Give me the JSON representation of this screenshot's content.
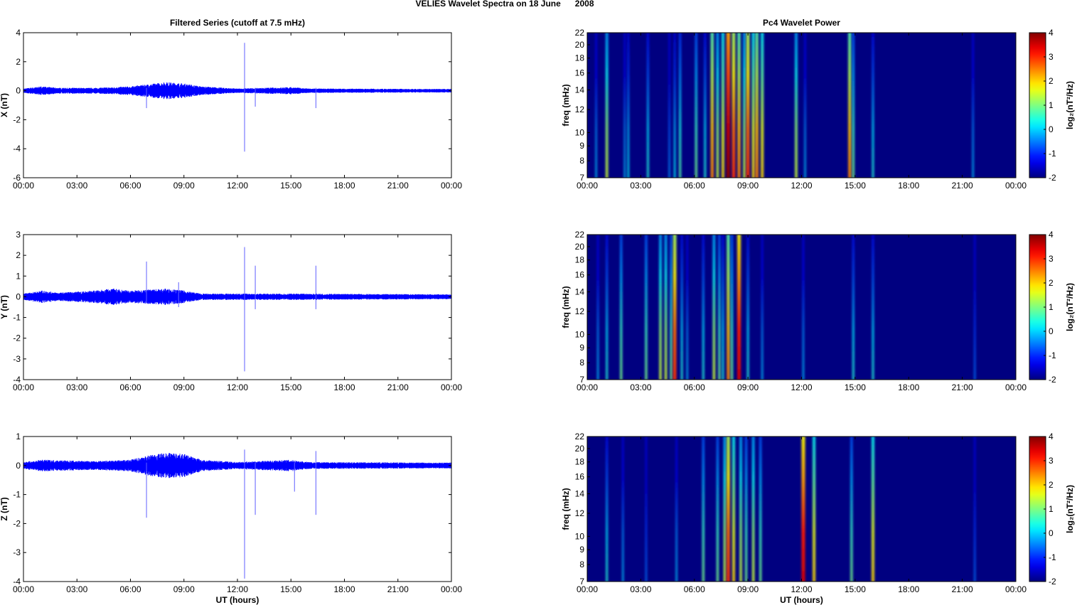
{
  "figure_title": "VELIES Wavelet Spectra on 18 June      2008",
  "chart_data": [
    {
      "type": "line",
      "title": "Filtered Series (cutoff at 7.5 mHz)",
      "ylabel": "X (nT)",
      "xlabel": "",
      "xlim": [
        0,
        24
      ],
      "ylim": [
        -6,
        4
      ],
      "yticks": [
        "4",
        "2",
        "0",
        "-2",
        "-4",
        "-6"
      ],
      "xticks": [
        "00:00",
        "03:00",
        "06:00",
        "09:00",
        "12:00",
        "15:00",
        "18:00",
        "21:00",
        "00:00"
      ],
      "color": "#0000ff",
      "noise_envelope_nT": [
        [
          0,
          0.15
        ],
        [
          1,
          0.3
        ],
        [
          2,
          0.2
        ],
        [
          4,
          0.2
        ],
        [
          6,
          0.3
        ],
        [
          7,
          0.45
        ],
        [
          8,
          0.6
        ],
        [
          9,
          0.5
        ],
        [
          10,
          0.3
        ],
        [
          12,
          0.15
        ],
        [
          15,
          0.25
        ],
        [
          16,
          0.15
        ],
        [
          24,
          0.12
        ]
      ],
      "spikes": [
        {
          "t": 6.9,
          "min": -1.2,
          "max": 0.2
        },
        {
          "t": 12.4,
          "min": -4.2,
          "max": 3.3
        },
        {
          "t": 13.0,
          "min": -1.1,
          "max": 0.2
        },
        {
          "t": 16.4,
          "min": -1.2,
          "max": 0.2
        }
      ]
    },
    {
      "type": "line",
      "title": "",
      "ylabel": "Y (nT)",
      "xlabel": "",
      "xlim": [
        0,
        24
      ],
      "ylim": [
        -4,
        3
      ],
      "yticks": [
        "3",
        "2",
        "1",
        "0",
        "-1",
        "-2",
        "-3",
        "-4"
      ],
      "xticks": [
        "00:00",
        "03:00",
        "06:00",
        "09:00",
        "12:00",
        "15:00",
        "18:00",
        "21:00",
        "00:00"
      ],
      "color": "#0000ff",
      "noise_envelope_nT": [
        [
          0,
          0.15
        ],
        [
          1,
          0.3
        ],
        [
          2,
          0.2
        ],
        [
          4,
          0.3
        ],
        [
          5,
          0.4
        ],
        [
          6,
          0.3
        ],
        [
          7,
          0.35
        ],
        [
          8,
          0.4
        ],
        [
          9,
          0.3
        ],
        [
          10,
          0.15
        ],
        [
          15,
          0.15
        ],
        [
          24,
          0.12
        ]
      ],
      "spikes": [
        {
          "t": 6.9,
          "min": -0.3,
          "max": 1.7
        },
        {
          "t": 8.7,
          "min": -0.5,
          "max": 0.7
        },
        {
          "t": 12.4,
          "min": -3.6,
          "max": 2.4
        },
        {
          "t": 13.0,
          "min": -0.6,
          "max": 1.5
        },
        {
          "t": 16.4,
          "min": -0.6,
          "max": 1.5
        }
      ]
    },
    {
      "type": "line",
      "title": "",
      "ylabel": "Z (nT)",
      "xlabel": "UT (hours)",
      "xlim": [
        0,
        24
      ],
      "ylim": [
        -4,
        1
      ],
      "yticks": [
        "1",
        "0",
        "-1",
        "-2",
        "-3",
        "-4"
      ],
      "xticks": [
        "00:00",
        "03:00",
        "06:00",
        "09:00",
        "12:00",
        "15:00",
        "18:00",
        "21:00",
        "00:00"
      ],
      "color": "#0000ff",
      "noise_envelope_nT": [
        [
          0,
          0.12
        ],
        [
          1,
          0.2
        ],
        [
          4,
          0.15
        ],
        [
          6,
          0.2
        ],
        [
          7,
          0.35
        ],
        [
          8,
          0.45
        ],
        [
          9,
          0.4
        ],
        [
          10,
          0.2
        ],
        [
          12,
          0.12
        ],
        [
          15,
          0.2
        ],
        [
          16,
          0.12
        ],
        [
          24,
          0.1
        ]
      ],
      "spikes": [
        {
          "t": 6.9,
          "min": -1.8,
          "max": 0.1
        },
        {
          "t": 12.4,
          "min": -3.9,
          "max": 0.55
        },
        {
          "t": 13.0,
          "min": -1.7,
          "max": 0.1
        },
        {
          "t": 15.2,
          "min": -0.9,
          "max": 0.1
        },
        {
          "t": 16.4,
          "min": -1.7,
          "max": 0.5
        }
      ]
    },
    {
      "type": "heatmap",
      "title": "Pc4 Wavelet Power",
      "ylabel": "freq (mHz)",
      "xlabel": "",
      "xlim": [
        0,
        24
      ],
      "ylim": [
        7,
        22
      ],
      "yscale": "log",
      "yticks": [
        "22",
        "20",
        "18",
        "16",
        "14",
        "12",
        "10",
        "9",
        "8",
        "7"
      ],
      "xticks": [
        "00:00",
        "03:00",
        "06:00",
        "09:00",
        "12:00",
        "15:00",
        "18:00",
        "21:00",
        "00:00"
      ],
      "colorbar": {
        "label": "log₂(nT²/Hz)",
        "range": [
          -2,
          4
        ],
        "ticks": [
          "4",
          "3",
          "2",
          "1",
          "0",
          "-1",
          "-2"
        ],
        "colormap": "jet"
      },
      "background_value": -2,
      "events": [
        [
          0.5,
          0
        ],
        [
          1.1,
          1.5
        ],
        [
          2.1,
          0
        ],
        [
          2.3,
          0.3
        ],
        [
          3.4,
          0.5
        ],
        [
          4.6,
          -0.3
        ],
        [
          4.9,
          0.3
        ],
        [
          5.2,
          0.8
        ],
        [
          6.1,
          1
        ],
        [
          6.6,
          0.5
        ],
        [
          7.0,
          2.5
        ],
        [
          7.3,
          1.5
        ],
        [
          7.6,
          2
        ],
        [
          7.9,
          4
        ],
        [
          8.2,
          3
        ],
        [
          8.5,
          2.5
        ],
        [
          8.8,
          1.5
        ],
        [
          9.0,
          3
        ],
        [
          9.3,
          2
        ],
        [
          9.5,
          2.5
        ],
        [
          9.8,
          2
        ],
        [
          11.7,
          1.5
        ],
        [
          12.2,
          0
        ],
        [
          14.7,
          2.5
        ],
        [
          14.9,
          1
        ],
        [
          16.0,
          0.5
        ],
        [
          21.6,
          0
        ]
      ]
    },
    {
      "type": "heatmap",
      "title": "",
      "ylabel": "freq (mHz)",
      "xlabel": "",
      "xlim": [
        0,
        24
      ],
      "ylim": [
        7,
        22
      ],
      "yscale": "log",
      "yticks": [
        "22",
        "20",
        "18",
        "16",
        "14",
        "12",
        "10",
        "9",
        "8",
        "7"
      ],
      "xticks": [
        "00:00",
        "03:00",
        "06:00",
        "09:00",
        "12:00",
        "15:00",
        "18:00",
        "21:00",
        "00:00"
      ],
      "colorbar": {
        "label": "log₂(nT²/Hz)",
        "range": [
          -2,
          4
        ],
        "ticks": [
          "4",
          "3",
          "2",
          "1",
          "0",
          "-1",
          "-2"
        ],
        "colormap": "jet"
      },
      "background_value": -2,
      "events": [
        [
          0.6,
          0
        ],
        [
          1.1,
          0.5
        ],
        [
          1.9,
          1
        ],
        [
          3.3,
          1
        ],
        [
          4.1,
          1.5
        ],
        [
          4.4,
          1.5
        ],
        [
          4.7,
          1
        ],
        [
          4.9,
          3
        ],
        [
          5.3,
          0.5
        ],
        [
          5.6,
          0
        ],
        [
          6.5,
          0.5
        ],
        [
          7.1,
          1.5
        ],
        [
          7.4,
          1
        ],
        [
          7.6,
          0.5
        ],
        [
          7.9,
          2.5
        ],
        [
          8.1,
          1
        ],
        [
          8.5,
          3.5
        ],
        [
          9.0,
          0.5
        ],
        [
          9.8,
          0
        ],
        [
          12.1,
          0
        ],
        [
          14.9,
          0.5
        ],
        [
          16.0,
          0.5
        ],
        [
          21.7,
          -0.5
        ]
      ]
    },
    {
      "type": "heatmap",
      "title": "",
      "ylabel": "freq (mHz)",
      "xlabel": "UT (hours)",
      "xlim": [
        0,
        24
      ],
      "ylim": [
        7,
        22
      ],
      "yscale": "log",
      "yticks": [
        "22",
        "20",
        "18",
        "16",
        "14",
        "12",
        "10",
        "9",
        "8",
        "7"
      ],
      "xticks": [
        "00:00",
        "03:00",
        "06:00",
        "09:00",
        "12:00",
        "15:00",
        "18:00",
        "21:00",
        "00:00"
      ],
      "colorbar": {
        "label": "log₂(nT²/Hz)",
        "range": [
          -2,
          4
        ],
        "ticks": [
          "4",
          "3",
          "2",
          "1",
          "0",
          "-1",
          "-2"
        ],
        "colormap": "jet"
      },
      "background_value": -2,
      "events": [
        [
          1.1,
          0.5
        ],
        [
          2.0,
          0
        ],
        [
          3.3,
          -0.5
        ],
        [
          5.0,
          0
        ],
        [
          6.5,
          1
        ],
        [
          7.3,
          1
        ],
        [
          7.7,
          1.5
        ],
        [
          7.9,
          3
        ],
        [
          8.2,
          2
        ],
        [
          8.6,
          1.5
        ],
        [
          8.9,
          1
        ],
        [
          9.3,
          1.5
        ],
        [
          9.7,
          1
        ],
        [
          12.1,
          3.5
        ],
        [
          12.7,
          2
        ],
        [
          14.8,
          1
        ],
        [
          16.0,
          2
        ],
        [
          21.7,
          -0.5
        ]
      ]
    }
  ]
}
